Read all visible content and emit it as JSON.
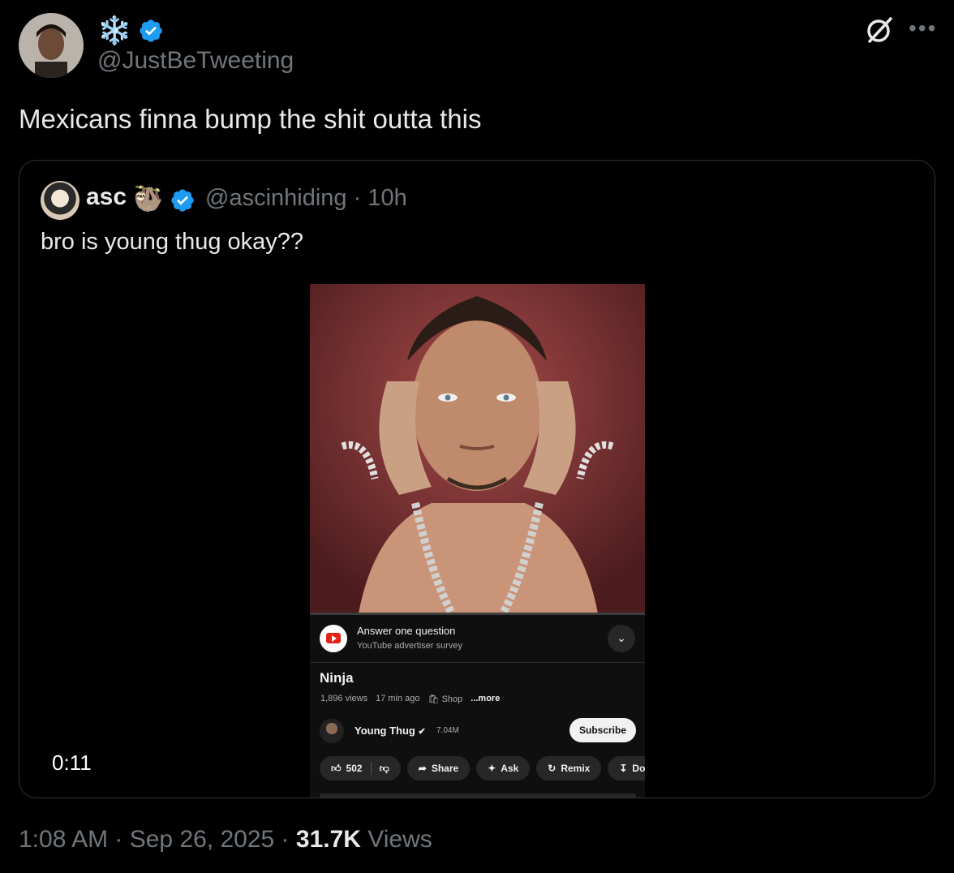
{
  "author": {
    "display_name": "❄️",
    "handle": "@JustBeTweeting",
    "verified_icon": "verified-badge-icon"
  },
  "tweet": {
    "text": "Mexicans finna bump the shit outta this"
  },
  "quote": {
    "name": "asc",
    "emoji": "🦥",
    "handle_time": "@ascinhiding · 10h",
    "text": "bro is young thug okay??",
    "video_time": "0:11",
    "video": {
      "survey_title": "Answer one question",
      "survey_sub": "YouTube advertiser survey",
      "title": "Ninja",
      "views": "1,896 views",
      "ago": "17 min ago",
      "shop": "Shop",
      "more": "...more",
      "channel": "Young Thug",
      "subs": "7.04M",
      "subscribe": "Subscribe",
      "likes": "502",
      "share": "Share",
      "ask": "Ask",
      "remix": "Remix",
      "download": "Dow"
    }
  },
  "footer": {
    "time_date": "1:08 AM · Sep 26, 2025 · ",
    "views_count": "31.7K",
    "views_label": " Views"
  },
  "colors": {
    "background": "#000000",
    "verified": "#1d9bf0",
    "muted": "#71767b"
  }
}
